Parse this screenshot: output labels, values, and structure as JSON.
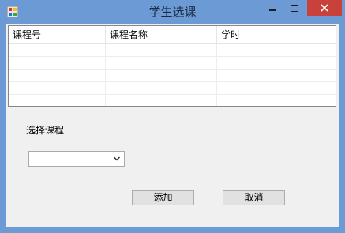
{
  "window": {
    "title": "学生选课"
  },
  "grid": {
    "columns": [
      "课程号",
      "课程名称",
      "学时"
    ],
    "rows": []
  },
  "form": {
    "course_label": "选择课程",
    "course_select_value": ""
  },
  "buttons": {
    "add_label": "添加",
    "cancel_label": "取消"
  },
  "colors": {
    "titlebar": "#6b9ad4",
    "close_button": "#c8413a",
    "client_background": "#f0f0f0"
  }
}
